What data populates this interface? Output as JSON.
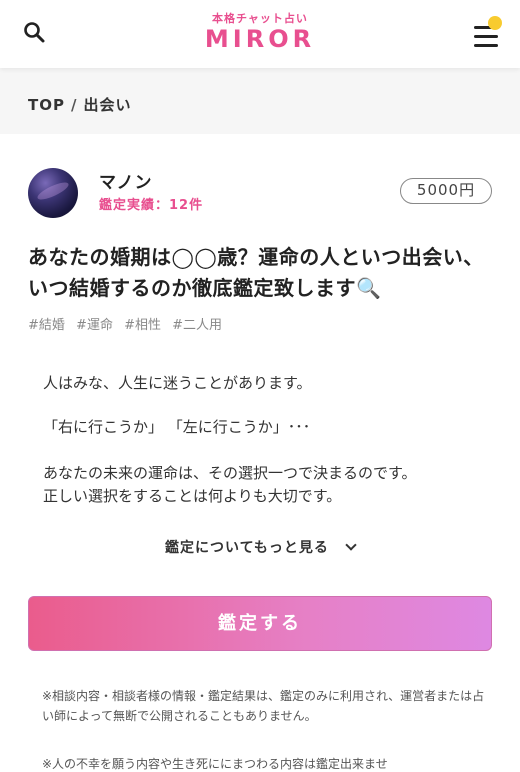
{
  "header": {
    "logo_sub": "本格チャット占い",
    "logo_main": "MIROR",
    "icons": {
      "search": "search-icon",
      "menu": "hamburger-menu-icon",
      "notification": "notification-dot-icon"
    },
    "colors": {
      "brand": "#e84f8f",
      "notification_dot": "#f8cb2f"
    }
  },
  "breadcrumb": {
    "items": [
      "TOP",
      "出会い"
    ],
    "separator": "/"
  },
  "fortune_teller": {
    "name": "マノン",
    "record": "鑑定実績：12件"
  },
  "price": "5000円",
  "title": "あなたの婚期は◯◯歳？運命の人といつ出会い、いつ結婚するのか徹底鑑定致します🔍",
  "tags": [
    "#結婚",
    "#運命",
    "#相性",
    "#二人用"
  ],
  "description": {
    "p1": "人はみな、人生に迷うことがあります。",
    "p2": "「右に行こうか」 「左に行こうか」･･･",
    "p3": "あなたの未来の運命は、その選択一つで決まるのです。",
    "p4": "正しい選択をすることは何よりも大切です。"
  },
  "more_link": "鑑定についてもっと見る",
  "cta": {
    "label": "鑑定する",
    "colors": {
      "start": "#ea5c8c",
      "end": "#de88e2"
    }
  },
  "notes": {
    "n1": "※相談内容・相談者様の情報・鑑定結果は、鑑定のみに利用され、運営者または占い師によって無断で公開されることもありません。",
    "n2": "※人の不幸を願う内容や生き死ににまつわる内容は鑑定出来ませ"
  }
}
